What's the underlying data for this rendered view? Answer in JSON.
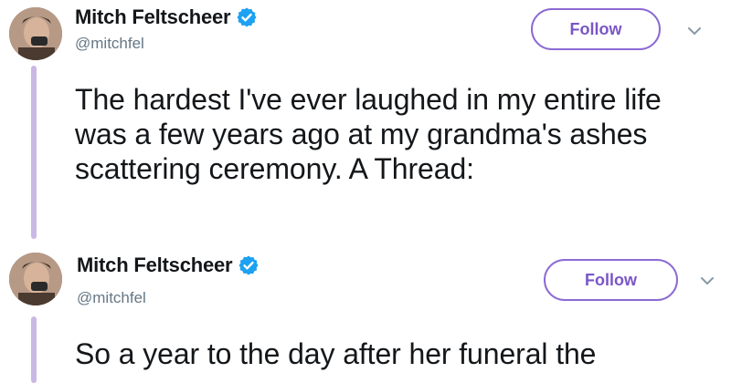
{
  "tweets": [
    {
      "author": {
        "name": "Mitch Feltscheer",
        "handle": "@mitchfel"
      },
      "follow_label": "Follow",
      "text": "The hardest I've ever laughed in my entire life was a few years ago at my grandma's ashes scattering ceremony. A Thread:"
    },
    {
      "author": {
        "name": "Mitch Feltscheer",
        "handle": "@mitchfel"
      },
      "follow_label": "Follow",
      "text": "So a year to the day after her funeral the"
    }
  ],
  "colors": {
    "thread_line": "#c9b8e4",
    "follow_accent": "#7a56c6",
    "verified": "#1da1f2",
    "handle": "#657786"
  },
  "icons": {
    "verified": "verified-badge-icon",
    "more": "chevron-down-icon"
  }
}
